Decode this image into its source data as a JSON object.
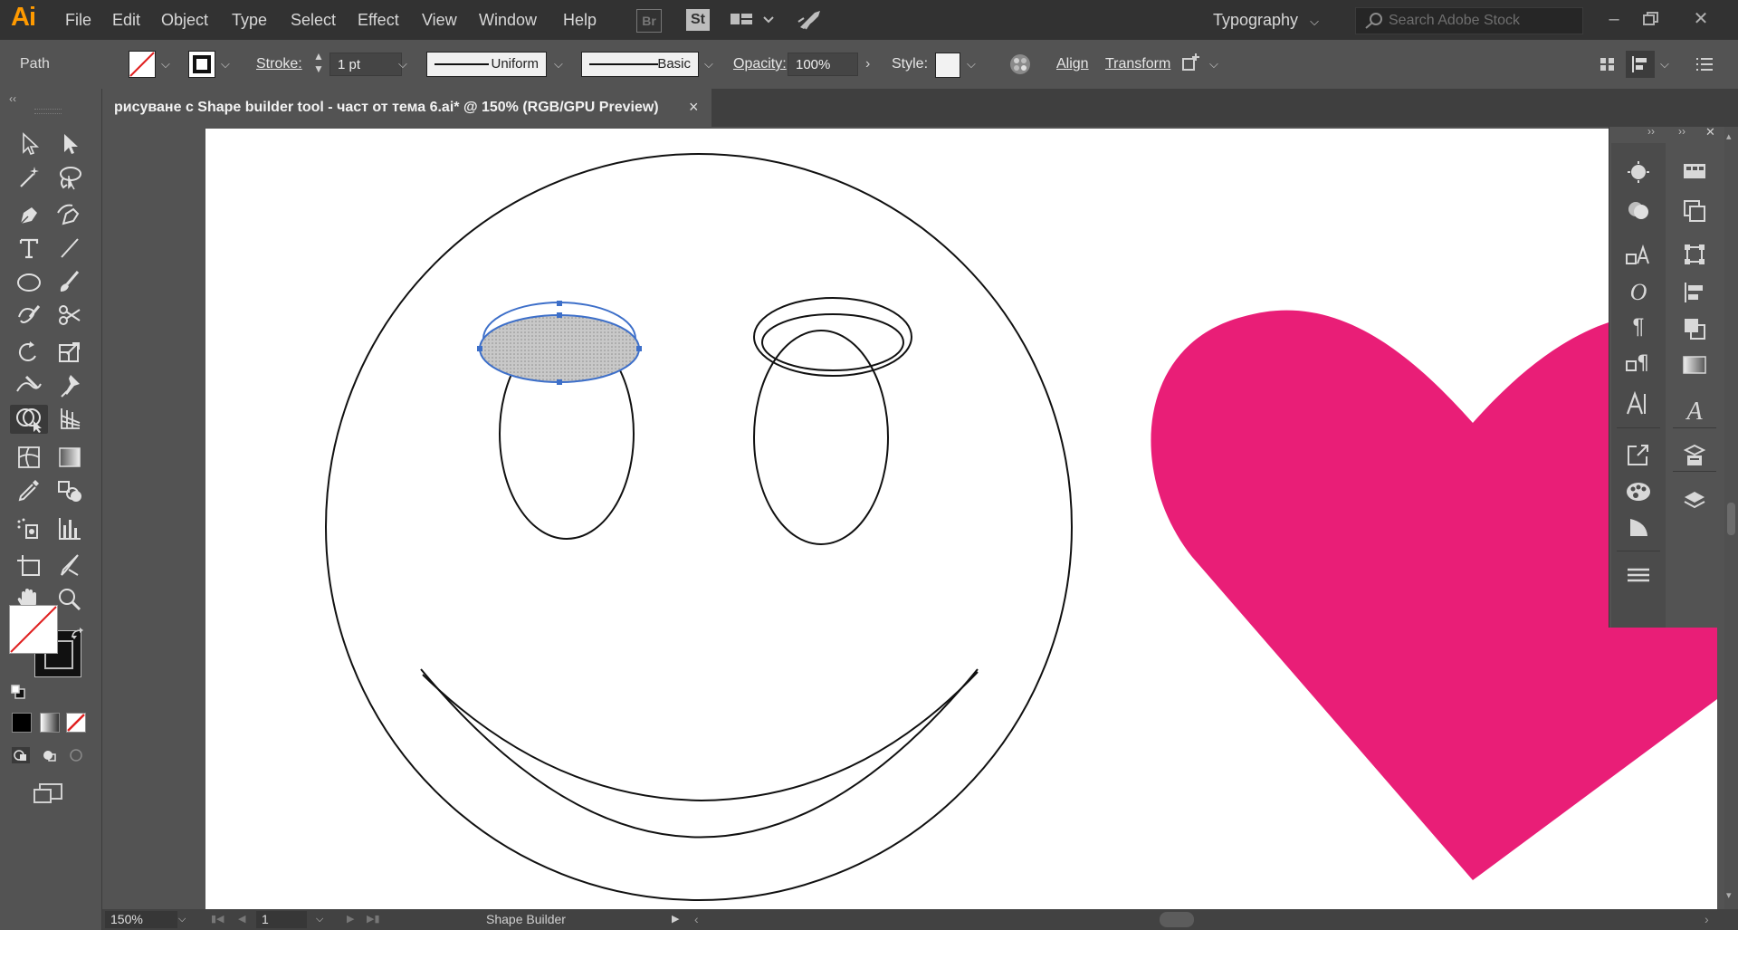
{
  "app": {
    "logo": "Ai",
    "accent": "#ff9a00"
  },
  "menu": {
    "items": [
      "File",
      "Edit",
      "Object",
      "Type",
      "Select",
      "Effect",
      "View",
      "Window",
      "Help"
    ]
  },
  "menubar_icons": {
    "bridge": "Br",
    "stock": "St"
  },
  "workspace": {
    "label": "Typography"
  },
  "search": {
    "placeholder": "Search Adobe Stock"
  },
  "control": {
    "selection_label": "Path",
    "stroke_label": "Stroke:",
    "stroke_weight": "1 pt",
    "profile": "Uniform",
    "brush": "Basic",
    "opacity_label": "Opacity:",
    "opacity_value": "100%",
    "style_label": "Style:",
    "align_label": "Align",
    "transform_label": "Transform"
  },
  "document": {
    "tab_title": "рисуване с Shape builder tool - част от тема 6.ai* @ 150% (RGB/GPU Preview)",
    "close_glyph": "×"
  },
  "status": {
    "zoom": "150%",
    "artboard_number": "1",
    "current_tool": "Shape Builder"
  },
  "colors": {
    "heart_fill": "#e91e77",
    "selection_blue": "#3d6fc9",
    "ui_dark": "#323232",
    "ui_mid": "#535353"
  },
  "toolbar_icons": [
    "selection-icon",
    "direct-selection-icon",
    "magic-wand-icon",
    "lasso-icon",
    "pen-icon",
    "curvature-icon",
    "type-icon",
    "line-segment-icon",
    "ellipse-icon",
    "paintbrush-icon",
    "shaper-icon",
    "scissors-icon",
    "rotate-icon",
    "scale-icon",
    "width-icon",
    "puppet-warp-icon",
    "shape-builder-icon",
    "perspective-grid-icon",
    "mesh-icon",
    "gradient-icon",
    "eyedropper-icon",
    "blend-icon",
    "symbol-sprayer-icon",
    "column-graph-icon",
    "artboard-icon",
    "slice-icon",
    "hand-icon",
    "zoom-icon"
  ],
  "right_panel_icons": [
    "appearance-icon",
    "color-guide-icon",
    "character-styles-icon",
    "opentype-icon",
    "paragraph-icon",
    "paragraph-styles-icon",
    "character-icon",
    "export-icon",
    "color-icon",
    "libraries-icon",
    "menu-icon",
    "swatches-icon",
    "artboards-icon",
    "transform-panel-icon",
    "align-panel-icon",
    "pathfinder-icon",
    "gradient-panel-icon",
    "glyphs-icon",
    "asset-export-icon",
    "layers-icon"
  ]
}
